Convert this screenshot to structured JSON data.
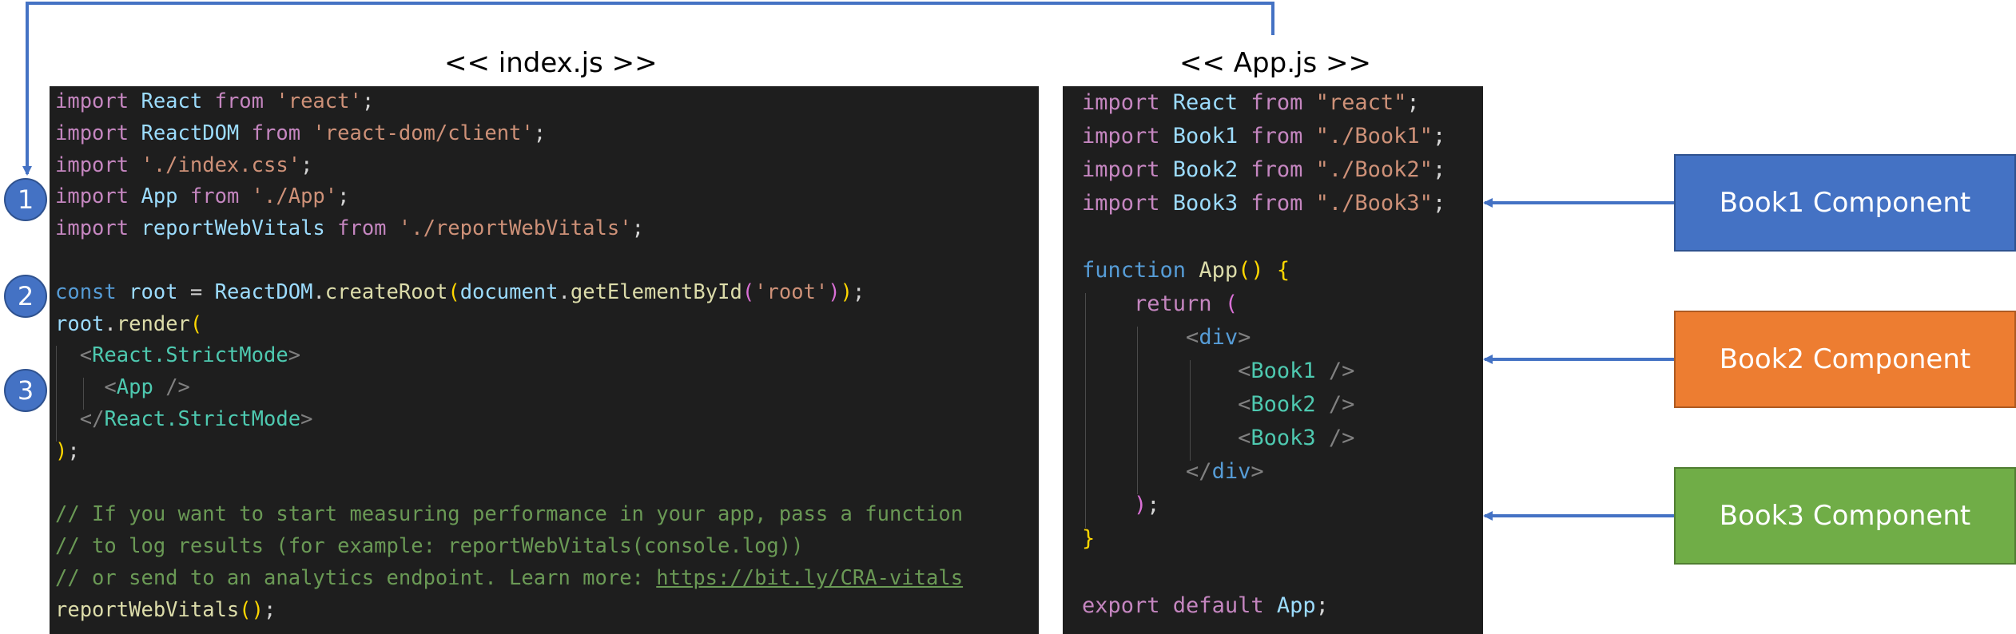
{
  "titles": {
    "index": "<< index.js >>",
    "app": "<< App.js >>"
  },
  "index_code": [
    [
      [
        "kw",
        "import "
      ],
      [
        "var",
        "React "
      ],
      [
        "kw",
        "from "
      ],
      [
        "str",
        "'react'"
      ],
      [
        "p",
        ";"
      ]
    ],
    [
      [
        "kw",
        "import "
      ],
      [
        "var",
        "ReactDOM "
      ],
      [
        "kw",
        "from "
      ],
      [
        "str",
        "'react-dom/client'"
      ],
      [
        "p",
        ";"
      ]
    ],
    [
      [
        "kw",
        "import "
      ],
      [
        "str",
        "'./index.css'"
      ],
      [
        "p",
        ";"
      ]
    ],
    [
      [
        "kw",
        "import "
      ],
      [
        "var",
        "App "
      ],
      [
        "kw",
        "from "
      ],
      [
        "str",
        "'./App'"
      ],
      [
        "p",
        ";"
      ]
    ],
    [
      [
        "kw",
        "import "
      ],
      [
        "var",
        "reportWebVitals "
      ],
      [
        "kw",
        "from "
      ],
      [
        "str",
        "'./reportWebVitals'"
      ],
      [
        "p",
        ";"
      ]
    ],
    [],
    [
      [
        "decl",
        "const "
      ],
      [
        "var",
        "root "
      ],
      [
        "p",
        "= "
      ],
      [
        "var",
        "ReactDOM"
      ],
      [
        "p",
        "."
      ],
      [
        "fn",
        "createRoot"
      ],
      [
        "b1",
        "("
      ],
      [
        "var",
        "document"
      ],
      [
        "p",
        "."
      ],
      [
        "fn",
        "getElementById"
      ],
      [
        "b2",
        "("
      ],
      [
        "str",
        "'root'"
      ],
      [
        "b2",
        ")"
      ],
      [
        "b1",
        ")"
      ],
      [
        "p",
        ";"
      ]
    ],
    [
      [
        "var",
        "root"
      ],
      [
        "p",
        "."
      ],
      [
        "fn",
        "render"
      ],
      [
        "b1",
        "("
      ]
    ],
    [
      [
        "p",
        "  "
      ],
      [
        "ang",
        "<"
      ],
      [
        "tag",
        "React.StrictMode"
      ],
      [
        "ang",
        ">"
      ]
    ],
    [
      [
        "p",
        "    "
      ],
      [
        "ang",
        "<"
      ],
      [
        "tag",
        "App "
      ],
      [
        "ang",
        "/>"
      ]
    ],
    [
      [
        "p",
        "  "
      ],
      [
        "ang",
        "</"
      ],
      [
        "tag",
        "React.StrictMode"
      ],
      [
        "ang",
        ">"
      ]
    ],
    [
      [
        "b1",
        ")"
      ],
      [
        "p",
        ";"
      ]
    ],
    [],
    [
      [
        "cmt",
        "// If you want to start measuring performance in your app, pass a function"
      ]
    ],
    [
      [
        "cmt",
        "// to log results (for example: reportWebVitals(console.log))"
      ]
    ],
    [
      [
        "cmt",
        "// or send to an analytics endpoint. Learn more: "
      ],
      [
        "link",
        "https://bit.ly/CRA-vitals"
      ]
    ],
    [
      [
        "fn",
        "reportWebVitals"
      ],
      [
        "b1",
        "("
      ],
      [
        "b1",
        ")"
      ],
      [
        "p",
        ";"
      ]
    ]
  ],
  "app_code": [
    [
      [
        "kw",
        "import "
      ],
      [
        "var",
        "React "
      ],
      [
        "kw",
        "from "
      ],
      [
        "str",
        "\"react\""
      ],
      [
        "p",
        ";"
      ]
    ],
    [
      [
        "kw",
        "import "
      ],
      [
        "var",
        "Book1 "
      ],
      [
        "kw",
        "from "
      ],
      [
        "str",
        "\"./Book1\""
      ],
      [
        "p",
        ";"
      ]
    ],
    [
      [
        "kw",
        "import "
      ],
      [
        "var",
        "Book2 "
      ],
      [
        "kw",
        "from "
      ],
      [
        "str",
        "\"./Book2\""
      ],
      [
        "p",
        ";"
      ]
    ],
    [
      [
        "kw",
        "import "
      ],
      [
        "var",
        "Book3 "
      ],
      [
        "kw",
        "from "
      ],
      [
        "str",
        "\"./Book3\""
      ],
      [
        "p",
        ";"
      ]
    ],
    [],
    [
      [
        "decl",
        "function "
      ],
      [
        "fn",
        "App"
      ],
      [
        "b1",
        "() {"
      ]
    ],
    [
      [
        "p",
        "    "
      ],
      [
        "kw",
        "return "
      ],
      [
        "b2",
        "("
      ]
    ],
    [
      [
        "p",
        "        "
      ],
      [
        "ang",
        "<"
      ],
      [
        "decl",
        "div"
      ],
      [
        "ang",
        ">"
      ]
    ],
    [
      [
        "p",
        "            "
      ],
      [
        "ang",
        "<"
      ],
      [
        "tag",
        "Book1 "
      ],
      [
        "ang",
        "/>"
      ]
    ],
    [
      [
        "p",
        "            "
      ],
      [
        "ang",
        "<"
      ],
      [
        "tag",
        "Book2 "
      ],
      [
        "ang",
        "/>"
      ]
    ],
    [
      [
        "p",
        "            "
      ],
      [
        "ang",
        "<"
      ],
      [
        "tag",
        "Book3 "
      ],
      [
        "ang",
        "/>"
      ]
    ],
    [
      [
        "p",
        "        "
      ],
      [
        "ang",
        "</"
      ],
      [
        "decl",
        "div"
      ],
      [
        "ang",
        ">"
      ]
    ],
    [
      [
        "p",
        "    "
      ],
      [
        "b2",
        ")"
      ],
      [
        "p",
        ";"
      ]
    ],
    [
      [
        "b1",
        "}"
      ]
    ],
    [],
    [
      [
        "kw",
        "export "
      ],
      [
        "kw",
        "default "
      ],
      [
        "var",
        "App"
      ],
      [
        "p",
        ";"
      ]
    ]
  ],
  "badges": [
    "1",
    "2",
    "3"
  ],
  "components": [
    {
      "label": "Book1 Component",
      "color": "#4472c4",
      "border": "#2f528f"
    },
    {
      "label": "Book2 Component",
      "color": "#ed7d31",
      "border": "#ae5a21"
    },
    {
      "label": "Book3 Component",
      "color": "#70ad47",
      "border": "#507e32"
    }
  ],
  "colors": {
    "connector": "#4472c4",
    "code_background": "#1e1e1e"
  }
}
